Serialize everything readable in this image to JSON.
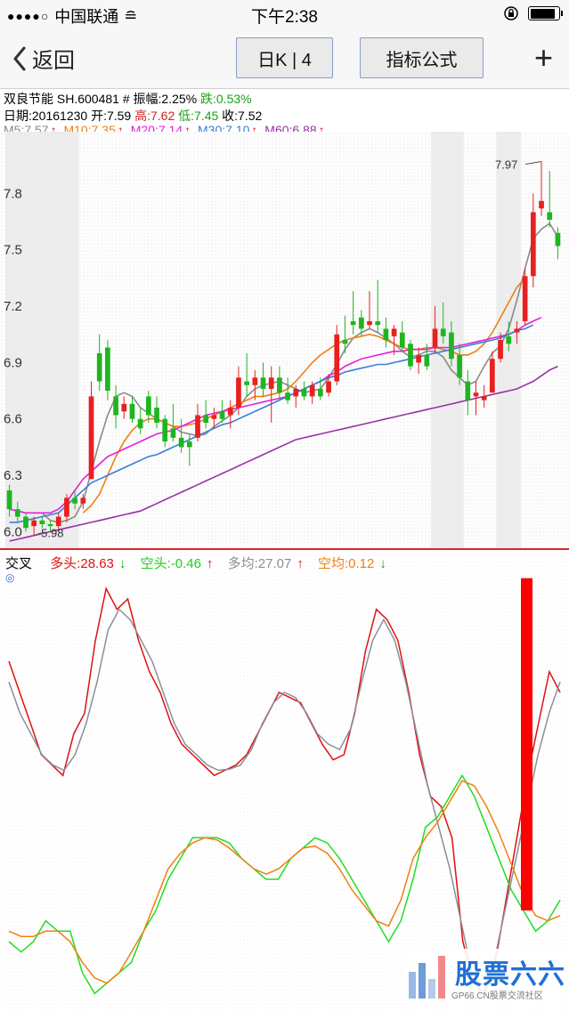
{
  "status": {
    "signal": "●●●●○",
    "carrier": "中国联通",
    "wifi": "≘",
    "time": "下午2:38",
    "orientation_lock_icon": "lock-rotation-icon"
  },
  "nav": {
    "back_label": "返回",
    "period_label": "日K | 4",
    "formula_label": "指标公式",
    "add_label": "+"
  },
  "stock": {
    "name": "双良节能",
    "code": "SH.600481",
    "amp_label": "# 振幅:2.25%",
    "change_label": "跌:0.53%",
    "date_label": "日期:20161230",
    "open": "开:7.59",
    "high": "高:7.62",
    "low": "低:7.45",
    "close": "收:7.52"
  },
  "ma_legend": [
    {
      "label": "M5:7.57",
      "arrow": "↑",
      "color": "#8a8a8a"
    },
    {
      "label": "M10:7.35",
      "arrow": "↑",
      "color": "#f07f12"
    },
    {
      "label": "M20:7.14",
      "arrow": "↑",
      "color": "#e61fd8"
    },
    {
      "label": "M30:7.10",
      "arrow": "↑",
      "color": "#3a7ed6"
    },
    {
      "label": "M60:6.88",
      "arrow": "↑",
      "color": "#9a30a8"
    }
  ],
  "chart_data": [
    {
      "type": "candlestick",
      "title": "",
      "ylim": [
        5.95,
        8.1
      ],
      "y_ticks": [
        "6.0",
        "6.3",
        "6.6",
        "6.9",
        "7.2",
        "7.5",
        "7.8"
      ],
      "annotations": {
        "high": "7.97",
        "low": "5.98"
      },
      "candles": [
        [
          6.22,
          6.25,
          6.08,
          6.12
        ],
        [
          6.12,
          6.16,
          6.05,
          6.08
        ],
        [
          6.08,
          6.1,
          6.0,
          6.02
        ],
        [
          6.03,
          6.08,
          5.98,
          6.06
        ],
        [
          6.06,
          6.08,
          6.02,
          6.04
        ],
        [
          6.04,
          6.06,
          6.0,
          6.03
        ],
        [
          6.03,
          6.1,
          6.01,
          6.08
        ],
        [
          6.08,
          6.2,
          6.05,
          6.18
        ],
        [
          6.18,
          6.22,
          6.12,
          6.15
        ],
        [
          6.15,
          6.2,
          6.12,
          6.18
        ],
        [
          6.28,
          6.8,
          6.28,
          6.72
        ],
        [
          6.95,
          7.05,
          6.75,
          6.8
        ],
        [
          6.98,
          7.02,
          6.7,
          6.75
        ],
        [
          6.72,
          6.78,
          6.55,
          6.62
        ],
        [
          6.64,
          6.72,
          6.6,
          6.68
        ],
        [
          6.68,
          6.72,
          6.58,
          6.6
        ],
        [
          6.6,
          6.66,
          6.52,
          6.55
        ],
        [
          6.72,
          6.75,
          6.58,
          6.62
        ],
        [
          6.66,
          6.72,
          6.55,
          6.58
        ],
        [
          6.6,
          6.62,
          6.45,
          6.48
        ],
        [
          6.55,
          6.68,
          6.48,
          6.5
        ],
        [
          6.5,
          6.6,
          6.42,
          6.45
        ],
        [
          6.48,
          6.52,
          6.35,
          6.45
        ],
        [
          6.5,
          6.68,
          6.48,
          6.62
        ],
        [
          6.62,
          6.7,
          6.55,
          6.58
        ],
        [
          6.6,
          6.66,
          6.55,
          6.62
        ],
        [
          6.64,
          6.7,
          6.58,
          6.6
        ],
        [
          6.62,
          6.7,
          6.55,
          6.66
        ],
        [
          6.66,
          6.88,
          6.62,
          6.82
        ],
        [
          6.8,
          6.95,
          6.72,
          6.78
        ],
        [
          6.78,
          6.86,
          6.7,
          6.82
        ],
        [
          6.82,
          6.9,
          6.72,
          6.76
        ],
        [
          6.76,
          6.88,
          6.58,
          6.82
        ],
        [
          6.82,
          6.88,
          6.7,
          6.74
        ],
        [
          6.74,
          6.82,
          6.68,
          6.7
        ],
        [
          6.72,
          6.78,
          6.66,
          6.76
        ],
        [
          6.76,
          6.8,
          6.7,
          6.72
        ],
        [
          6.72,
          6.8,
          6.68,
          6.78
        ],
        [
          6.76,
          6.82,
          6.7,
          6.72
        ],
        [
          6.74,
          6.84,
          6.72,
          6.8
        ],
        [
          6.8,
          7.1,
          6.78,
          7.05
        ],
        [
          7.02,
          7.15,
          6.95,
          7.0
        ],
        [
          7.12,
          7.28,
          7.05,
          7.1
        ],
        [
          7.14,
          7.18,
          7.04,
          7.08
        ],
        [
          7.1,
          7.28,
          7.08,
          7.12
        ],
        [
          7.12,
          7.34,
          7.06,
          7.1
        ],
        [
          7.08,
          7.14,
          6.98,
          7.02
        ],
        [
          7.04,
          7.1,
          6.94,
          7.08
        ],
        [
          7.06,
          7.12,
          6.96,
          6.98
        ],
        [
          7.0,
          7.02,
          6.86,
          6.88
        ],
        [
          6.9,
          6.98,
          6.84,
          6.94
        ],
        [
          6.94,
          7.0,
          6.86,
          6.88
        ],
        [
          6.98,
          7.2,
          6.95,
          7.08
        ],
        [
          7.08,
          7.22,
          7.0,
          7.04
        ],
        [
          7.06,
          7.12,
          6.88,
          6.92
        ],
        [
          6.94,
          7.0,
          6.78,
          6.82
        ],
        [
          6.8,
          6.86,
          6.62,
          6.7
        ],
        [
          6.72,
          6.8,
          6.62,
          6.74
        ],
        [
          6.7,
          6.78,
          6.66,
          6.72
        ],
        [
          6.74,
          6.96,
          6.74,
          6.92
        ],
        [
          6.92,
          7.06,
          6.9,
          7.02
        ],
        [
          7.04,
          7.12,
          6.96,
          7.0
        ],
        [
          7.06,
          7.12,
          7.0,
          7.08
        ],
        [
          7.12,
          7.4,
          7.1,
          7.36
        ],
        [
          7.36,
          7.8,
          7.3,
          7.7
        ],
        [
          7.72,
          7.97,
          7.68,
          7.76
        ],
        [
          7.7,
          7.92,
          7.62,
          7.66
        ],
        [
          7.59,
          7.62,
          7.45,
          7.52
        ]
      ],
      "ma_series": [
        {
          "name": "M5",
          "start": 4,
          "values": [
            6.1,
            6.06,
            6.05,
            6.06,
            6.08,
            6.16,
            6.32,
            6.48,
            6.62,
            6.72,
            6.74,
            6.72,
            6.66,
            6.63,
            6.6,
            6.58,
            6.56,
            6.53,
            6.52,
            6.51,
            6.52,
            6.56,
            6.59,
            6.62,
            6.66,
            6.72,
            6.76,
            6.78,
            6.79,
            6.8,
            6.78,
            6.76,
            6.74,
            6.75,
            6.76,
            6.82,
            6.89,
            6.97,
            7.03,
            7.06,
            7.08,
            7.06,
            7.03,
            7.0,
            6.96,
            6.93,
            6.94,
            6.96,
            6.96,
            6.93,
            6.86,
            6.82,
            6.78,
            6.8,
            6.88,
            6.95,
            6.99,
            7.08,
            7.23,
            7.4,
            7.56,
            7.61,
            7.64,
            7.57
          ]
        },
        {
          "name": "M10",
          "start": 9,
          "values": [
            6.1,
            6.14,
            6.2,
            6.3,
            6.4,
            6.48,
            6.54,
            6.58,
            6.6,
            6.6,
            6.58,
            6.56,
            6.56,
            6.57,
            6.58,
            6.6,
            6.62,
            6.64,
            6.66,
            6.68,
            6.7,
            6.72,
            6.72,
            6.73,
            6.74,
            6.76,
            6.8,
            6.85,
            6.9,
            6.94,
            6.97,
            7.0,
            7.02,
            7.03,
            7.04,
            7.05,
            7.04,
            7.02,
            7.0,
            6.98,
            6.97,
            6.97,
            6.98,
            6.98,
            6.97,
            6.96,
            6.94,
            6.94,
            6.96,
            7.0,
            7.06,
            7.14,
            7.22,
            7.3,
            7.35
          ]
        },
        {
          "name": "M20",
          "start": 0,
          "values": [
            6.12,
            6.11,
            6.1,
            6.1,
            6.1,
            6.1,
            6.12,
            6.16,
            6.22,
            6.28,
            6.32,
            6.36,
            6.4,
            6.42,
            6.44,
            6.46,
            6.48,
            6.5,
            6.52,
            6.53,
            6.54,
            6.56,
            6.58,
            6.6,
            6.62,
            6.63,
            6.64,
            6.65,
            6.66,
            6.67,
            6.68,
            6.69,
            6.7,
            6.71,
            6.72,
            6.74,
            6.76,
            6.78,
            6.8,
            6.83,
            6.85,
            6.88,
            6.9,
            6.92,
            6.93,
            6.94,
            6.95,
            6.96,
            6.96,
            6.97,
            6.97,
            6.97,
            6.98,
            6.98,
            6.98,
            6.99,
            7.0,
            7.01,
            7.02,
            7.03,
            7.04,
            7.05,
            7.07,
            7.1,
            7.12,
            7.14
          ]
        },
        {
          "name": "M30",
          "start": 0,
          "values": [
            6.05,
            6.05,
            6.06,
            6.07,
            6.08,
            6.09,
            6.1,
            6.14,
            6.18,
            6.22,
            6.26,
            6.28,
            6.3,
            6.32,
            6.34,
            6.36,
            6.38,
            6.4,
            6.41,
            6.43,
            6.45,
            6.47,
            6.49,
            6.51,
            6.53,
            6.55,
            6.57,
            6.58,
            6.6,
            6.62,
            6.64,
            6.66,
            6.68,
            6.7,
            6.72,
            6.74,
            6.76,
            6.78,
            6.8,
            6.82,
            6.83,
            6.85,
            6.86,
            6.87,
            6.88,
            6.89,
            6.89,
            6.9,
            6.91,
            6.92,
            6.93,
            6.94,
            6.95,
            6.96,
            6.97,
            6.98,
            6.99,
            7.0,
            7.01,
            7.02,
            7.03,
            7.05,
            7.07,
            7.08,
            7.1
          ]
        },
        {
          "name": "M60",
          "start": 0,
          "values": [
            5.95,
            5.96,
            5.97,
            5.98,
            5.99,
            6.0,
            6.01,
            6.02,
            6.03,
            6.04,
            6.05,
            6.06,
            6.07,
            6.08,
            6.09,
            6.1,
            6.11,
            6.13,
            6.15,
            6.17,
            6.19,
            6.21,
            6.23,
            6.25,
            6.27,
            6.29,
            6.31,
            6.33,
            6.35,
            6.37,
            6.39,
            6.41,
            6.43,
            6.45,
            6.47,
            6.49,
            6.5,
            6.51,
            6.52,
            6.53,
            6.54,
            6.55,
            6.56,
            6.57,
            6.58,
            6.59,
            6.6,
            6.61,
            6.62,
            6.63,
            6.64,
            6.65,
            6.66,
            6.67,
            6.68,
            6.69,
            6.7,
            6.71,
            6.72,
            6.73,
            6.74,
            6.75,
            6.76,
            6.78,
            6.8,
            6.83,
            6.86,
            6.88
          ]
        }
      ],
      "highlight_bands": [
        [
          0,
          8
        ],
        [
          52,
          55
        ],
        [
          60,
          62
        ]
      ]
    },
    {
      "type": "line",
      "title": "交叉",
      "ylim": [
        -1.2,
        3.0
      ],
      "series": [
        {
          "name": "多头",
          "label": "多头:28.63",
          "arrow": "↓",
          "color": "#e01010",
          "values": [
            2.1,
            1.8,
            1.5,
            1.2,
            1.1,
            1.0,
            1.4,
            1.6,
            2.3,
            2.8,
            2.6,
            2.7,
            2.3,
            2.0,
            1.8,
            1.5,
            1.3,
            1.2,
            1.1,
            1.0,
            1.05,
            1.1,
            1.2,
            1.4,
            1.6,
            1.8,
            1.75,
            1.7,
            1.5,
            1.3,
            1.15,
            1.2,
            1.6,
            2.2,
            2.6,
            2.5,
            2.3,
            1.8,
            1.2,
            0.8,
            0.7,
            0.4,
            -0.6,
            -1.0,
            -1.1,
            -0.8,
            -0.2,
            0.4,
            1.0,
            1.5,
            2.0,
            1.8
          ]
        },
        {
          "name": "空头",
          "label": "空头:-0.46",
          "arrow": "↑",
          "color": "#22dd22",
          "values": [
            -0.6,
            -0.7,
            -0.6,
            -0.4,
            -0.5,
            -0.5,
            -0.9,
            -1.1,
            -1.0,
            -0.9,
            -0.8,
            -0.5,
            -0.3,
            0.0,
            0.2,
            0.4,
            0.4,
            0.4,
            0.35,
            0.2,
            0.1,
            0.0,
            0.0,
            0.2,
            0.3,
            0.4,
            0.35,
            0.2,
            0.0,
            -0.2,
            -0.4,
            -0.6,
            -0.4,
            0.0,
            0.5,
            0.6,
            0.8,
            1.0,
            0.8,
            0.5,
            0.2,
            -0.1,
            -0.3,
            -0.5,
            -0.4,
            -0.2
          ]
        },
        {
          "name": "多均",
          "label": "多均:27.07",
          "arrow": "↑",
          "color": "#8a9096",
          "values": [
            1.9,
            1.6,
            1.4,
            1.2,
            1.1,
            1.05,
            1.2,
            1.5,
            1.9,
            2.4,
            2.6,
            2.5,
            2.3,
            2.1,
            1.8,
            1.5,
            1.3,
            1.2,
            1.1,
            1.05,
            1.06,
            1.1,
            1.25,
            1.5,
            1.7,
            1.8,
            1.75,
            1.6,
            1.4,
            1.3,
            1.25,
            1.45,
            1.9,
            2.3,
            2.5,
            2.3,
            1.9,
            1.4,
            0.9,
            0.5,
            0.1,
            -0.4,
            -0.9,
            -1.1,
            -0.8,
            -0.3,
            0.2,
            0.7,
            1.2,
            1.6,
            1.9
          ]
        },
        {
          "name": "空均",
          "label": "空均:0.12",
          "arrow": "↓",
          "color": "#f08010",
          "values": [
            -0.5,
            -0.55,
            -0.55,
            -0.5,
            -0.5,
            -0.6,
            -0.8,
            -0.95,
            -1.0,
            -0.9,
            -0.7,
            -0.5,
            -0.2,
            0.1,
            0.25,
            0.35,
            0.4,
            0.38,
            0.3,
            0.2,
            0.1,
            0.05,
            0.1,
            0.2,
            0.3,
            0.32,
            0.25,
            0.1,
            -0.1,
            -0.25,
            -0.4,
            -0.45,
            -0.2,
            0.2,
            0.4,
            0.55,
            0.75,
            0.95,
            0.9,
            0.7,
            0.45,
            0.15,
            -0.15,
            -0.35,
            -0.4,
            -0.35
          ]
        }
      ],
      "signal_bar": {
        "value": 2.9,
        "color": "#ff0000"
      }
    }
  ],
  "watermark": {
    "title": "股票六六",
    "sub": "GP66.CN股票交流社区"
  }
}
